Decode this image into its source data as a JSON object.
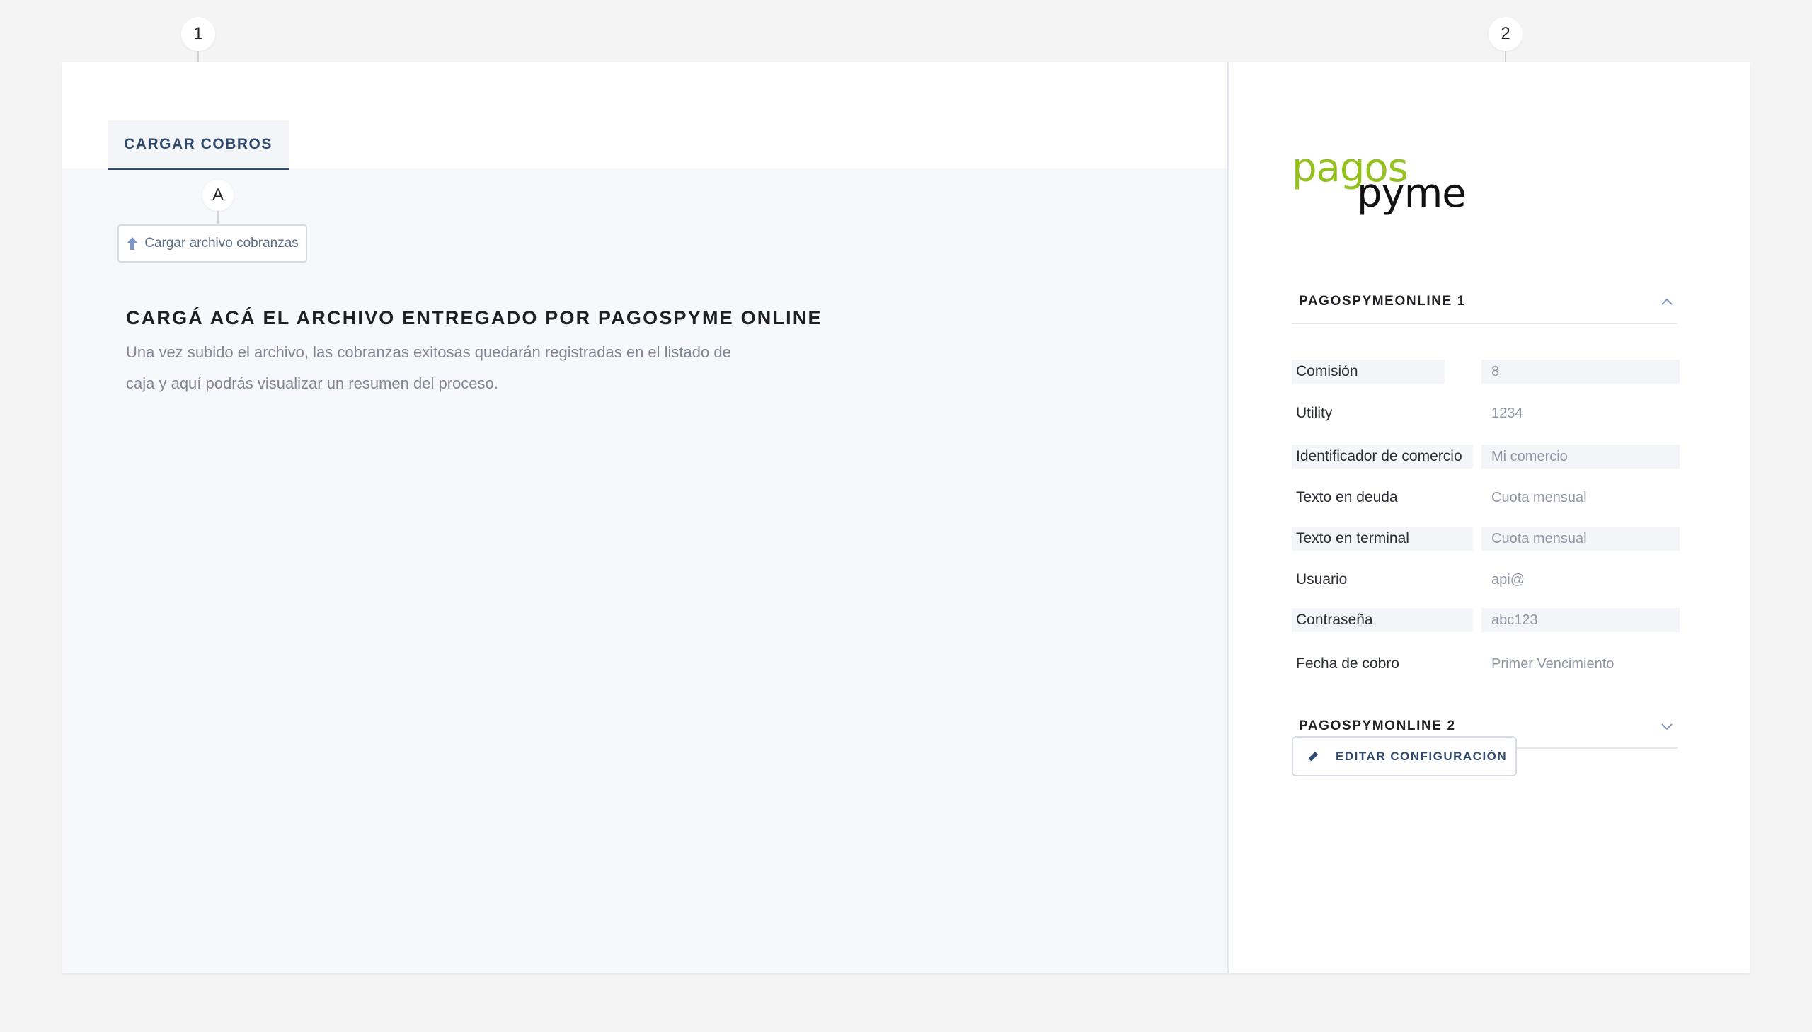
{
  "callouts": {
    "one": "1",
    "two": "2",
    "a": "A"
  },
  "left": {
    "tab_label": "CARGAR COBROS",
    "upload_button_label": "Cargar archivo cobranzas",
    "headline": "CARGÁ ACÁ EL ARCHIVO ENTREGADO POR PAGOSPYME ONLINE",
    "description": "Una vez subido el archivo, las cobranzas exitosas quedarán registradas en el listado de caja y aquí podrás visualizar un resumen del proceso."
  },
  "right": {
    "logo": {
      "line1": "pagos",
      "line2": "pyme",
      "colors": {
        "line1": "#95c11f",
        "line2": "#111111"
      }
    },
    "section1": {
      "title": "PAGOSPYMEONLINE 1",
      "expanded": true,
      "fields": [
        {
          "label": "Comisión",
          "value": "8"
        },
        {
          "label": "Utility",
          "value": "1234"
        },
        {
          "label": "Identificador de comercio",
          "value": "Mi comercio"
        },
        {
          "label": "Texto en deuda",
          "value": "Cuota mensual"
        },
        {
          "label": "Texto en terminal",
          "value": "Cuota mensual"
        },
        {
          "label": "Usuario",
          "value": "api@"
        },
        {
          "label": "Contraseña",
          "value": "abc123"
        },
        {
          "label": "Fecha de cobro",
          "value": "Primer Vencimiento"
        }
      ]
    },
    "section2": {
      "title": "PAGOSPYMONLINE 2",
      "expanded": false
    },
    "edit_button_label": "EDITAR CONFIGURACIÓN"
  },
  "icons": {
    "upload": "upload-arrow-icon",
    "chevron_up": "chevron-up-icon",
    "chevron_down": "chevron-down-icon",
    "edit": "pencil-icon"
  },
  "colors": {
    "accent": "#2f4a6e",
    "logo_green": "#95c11f"
  }
}
